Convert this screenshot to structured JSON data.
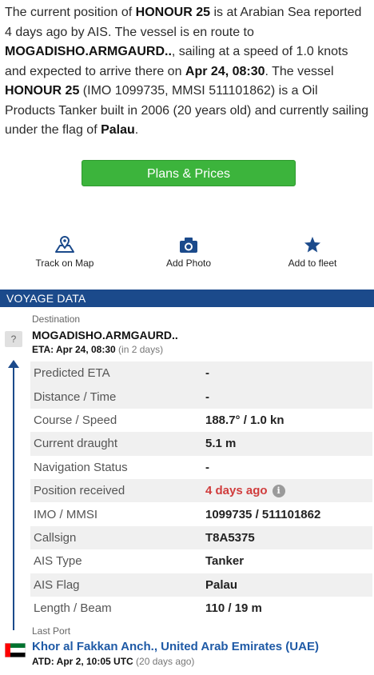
{
  "intro": {
    "p1": "The current position of ",
    "vessel_name": "HONOUR 25",
    "p2": " is at Arabian Sea reported 4 days ago by AIS. The vessel is en route to ",
    "destination": "MOGADISHO.ARMGAURD..",
    "p3": ", sailing at a speed of 1.0 knots and expected to arrive there on ",
    "eta": "Apr 24, 08:30",
    "p4": ". The vessel ",
    "vessel_name_2": "HONOUR 25",
    "p5": " (IMO 1099735, MMSI 511101862) is a Oil Products Tanker built in 2006 (20 years old) and currently sailing under the flag of ",
    "flag": "Palau",
    "p6": "."
  },
  "buttons": {
    "plans_prices": "Plans & Prices"
  },
  "actions": [
    {
      "label": "Track on Map",
      "icon": "map-pin-icon"
    },
    {
      "label": "Add Photo",
      "icon": "camera-icon"
    },
    {
      "label": "Add to fleet",
      "icon": "star-icon"
    }
  ],
  "voyage": {
    "header": "VOYAGE DATA",
    "destination_label": "Destination",
    "unknown_port_icon": "?",
    "destination_name": "MOGADISHO.ARMGAURD..",
    "eta_prefix": "ETA: Apr 24, 08:30",
    "eta_relative": "(in 2 days)",
    "rows": [
      {
        "k": "Predicted ETA",
        "v": "-"
      },
      {
        "k": "Distance / Time",
        "v": "-"
      },
      {
        "k": "Course / Speed",
        "v": "188.7° / 1.0 kn"
      },
      {
        "k": "Current draught",
        "v": "5.1 m"
      },
      {
        "k": "Navigation Status",
        "v": "-"
      },
      {
        "k": "Position received",
        "v": "4 days ago"
      },
      {
        "k": "IMO / MMSI",
        "v": "1099735 / 511101862"
      },
      {
        "k": "Callsign",
        "v": "T8A5375"
      },
      {
        "k": "AIS Type",
        "v": "Tanker"
      },
      {
        "k": "AIS Flag",
        "v": "Palau"
      },
      {
        "k": "Length / Beam",
        "v": "110 / 19 m"
      }
    ],
    "info_icon": "i",
    "last_port_label": "Last Port",
    "last_port_name": "Khor al Fakkan Anch., United Arab Emirates (UAE)",
    "atd_prefix": "ATD: Apr 2, 10:05 UTC",
    "atd_relative": "(20 days ago)"
  },
  "colors": {
    "brand_blue": "#1b4a8b",
    "button_green": "#3cb43c",
    "alert_red": "#d03c3c",
    "link_blue": "#1f5aa6"
  }
}
